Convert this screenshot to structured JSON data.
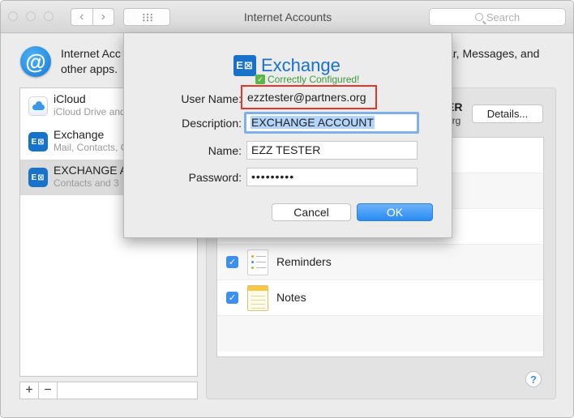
{
  "window": {
    "title": "Internet Accounts",
    "search_placeholder": "Search"
  },
  "header": {
    "text_line1": "Internet Acc",
    "text_line2": "other apps.",
    "text_tail": "ar, Messages, and"
  },
  "sidebar": {
    "accounts": [
      {
        "name": "iCloud",
        "subtitle": "iCloud Drive and",
        "icon": "icloud-icon",
        "selected": false
      },
      {
        "name": "Exchange",
        "subtitle": "Mail, Contacts, C",
        "icon": "exchange-icon",
        "selected": false
      },
      {
        "name": "EXCHANGE A",
        "subtitle": "Contacts and 3",
        "icon": "exchange-icon",
        "selected": true
      }
    ],
    "add_label": "+",
    "remove_label": "−"
  },
  "account_panel": {
    "name_tail": "ER",
    "sub_tail": "org",
    "details_label": "Details...",
    "services": [
      {
        "label": "Reminders",
        "checked": true,
        "icon": "reminders-icon"
      },
      {
        "label": "Notes",
        "checked": true,
        "icon": "notes-icon"
      }
    ],
    "help_label": "?"
  },
  "sheet": {
    "logo_text": "Exchange",
    "logo_icon_text": "E⊠",
    "status_text": "Correctly Configured!",
    "fields": {
      "username_label": "User Name:",
      "username_value": "ezztester@partners.org",
      "description_label": "Description:",
      "description_value": "EXCHANGE ACCOUNT",
      "name_label": "Name:",
      "name_value": "EZZ TESTER",
      "password_label": "Password:",
      "password_value": "•••••••••"
    },
    "cancel_label": "Cancel",
    "ok_label": "OK"
  },
  "colors": {
    "accent": "#2a8bf1",
    "highlight": "#e0362b",
    "status": "#3a9a3a",
    "exchange_blue": "#1872c9"
  }
}
